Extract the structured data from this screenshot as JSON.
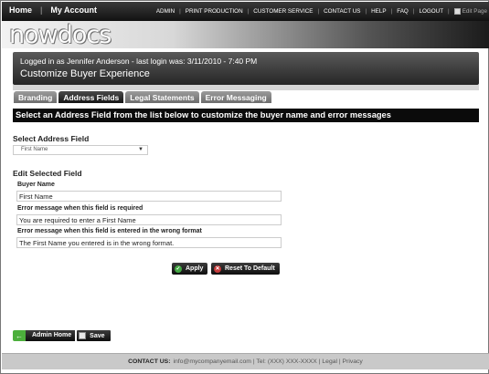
{
  "topnav": {
    "home": "Home",
    "my_account": "My Account",
    "links": [
      "ADMIN",
      "PRINT PRODUCTION",
      "CUSTOMER SERVICE",
      "CONTACT US",
      "HELP",
      "FAQ",
      "LOGOUT"
    ],
    "edit_page": "Edit Page"
  },
  "logo": "nowdocs",
  "welcome": {
    "login_text": "Logged in as Jennifer Anderson - last login was: 3/11/2010 - 7:40 PM",
    "title": "Customize Buyer Experience"
  },
  "tabs": [
    "Branding",
    "Address Fields",
    "Legal Statements",
    "Error Messaging"
  ],
  "active_tab": "Address Fields",
  "banner": "Select an Address Field from the list below to customize the buyer name and error messages",
  "select_section": {
    "label": "Select Address Field",
    "selected": "First Name"
  },
  "edit_section": {
    "label": "Edit Selected Field",
    "buyer_name_label": "Buyer Name",
    "buyer_name_value": "First Name",
    "required_label": "Error message when this field is required",
    "required_value": "You are required to enter a First Name",
    "format_label": "Error message when this field is entered in the wrong format",
    "format_value": "The First Name you entered is in the wrong format."
  },
  "buttons": {
    "apply": "Apply",
    "reset": "Reset To Default",
    "admin_home": "Admin Home",
    "save": "Save"
  },
  "footer": {
    "contact_label": "CONTACT US:",
    "contact_text": "info@mycompanyemail.com | Tel: (XXX) XXX-XXXX | Legal | Privacy"
  },
  "colors": {
    "accent_green": "#43a843",
    "accent_red": "#c63b3b",
    "dark": "#0b0b0b"
  }
}
